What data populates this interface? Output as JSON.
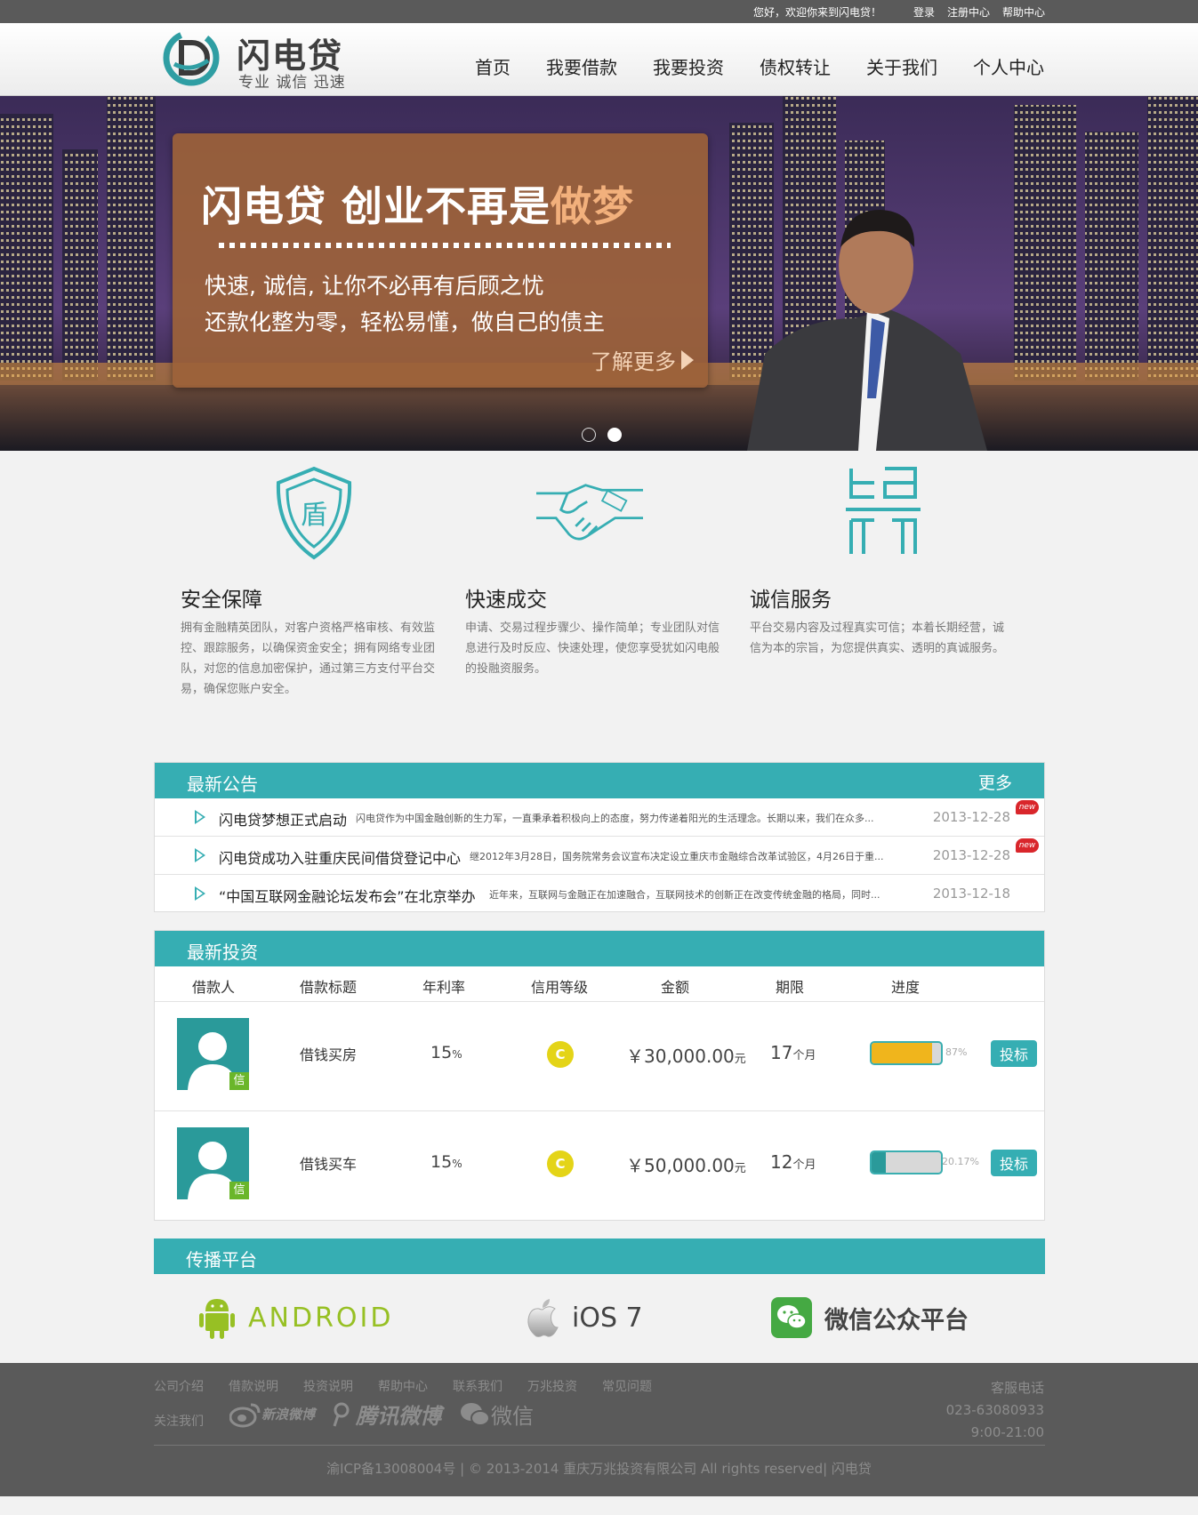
{
  "topbar": {
    "welcome": "您好，欢迎你来到闪电贷！",
    "login": "登录",
    "register": "注册中心",
    "help": "帮助中心"
  },
  "brand": {
    "name": "闪电贷",
    "slogan": "专业 诚信 迅速",
    "color": "#36aeb3"
  },
  "nav": [
    "首页",
    "我要借款",
    "我要投资",
    "债权转让",
    "关于我们",
    "个人中心"
  ],
  "banner": {
    "title_main": "闪电贷 创业不再是",
    "title_highlight": "做梦",
    "line1": "快速, 诚信, 让你不必再有后顾之忧",
    "line2": "还款化整为零，轻松易懂，做自己的债主",
    "more": "了解更多",
    "slides": 2,
    "active_slide": 2
  },
  "features": [
    {
      "icon": "shield-icon",
      "icon_text": "盾",
      "title": "安全保障",
      "desc": "拥有金融精英团队，对客户资格严格审核、有效监控、跟踪服务，以确保资金安全；拥有网络专业团队，对您的信息加密保护，通过第三方支付平台交易，确保您账户安全。"
    },
    {
      "icon": "handshake-icon",
      "title": "快速成交",
      "desc": "申请、交易过程步骤少、操作简单；专业团队对信息进行及时反应、快速处理，使您享受犹如闪电般的投融资服务。"
    },
    {
      "icon": "seal-icon",
      "title": "诚信服务",
      "desc": "平台交易内容及过程真实可信；本着长期经营，诚信为本的宗旨，为您提供真实、透明的真诚服务。"
    }
  ],
  "notices": {
    "title": "最新公告",
    "more": "更多",
    "items": [
      {
        "title": "闪电贷梦想正式启动",
        "summary": "闪电贷作为中国金融创新的生力军，一直秉承着积极向上的态度，努力传递着阳光的生活理念。长期以来，我们在众多...",
        "date": "2013-12-28",
        "badge": "new"
      },
      {
        "title": "闪电贷成功入驻重庆民间借贷登记中心",
        "summary": "继2012年3月28日，国务院常务会议宣布决定设立重庆市金融综合改革试验区，4月26日于重...",
        "date": "2013-12-28",
        "badge": "new"
      },
      {
        "title": "“中国互联网金融论坛发布会”在北京举办",
        "summary": "近年来，互联网与金融正在加速融合，互联网技术的创新正在改变传统金融的格局，同时...",
        "date": "2013-12-18",
        "badge": ""
      }
    ]
  },
  "investments": {
    "title": "最新投资",
    "columns": [
      "借款人",
      "借款标题",
      "年利率",
      "信用等级",
      "金额",
      "期限",
      "进度"
    ],
    "rows": [
      {
        "avatar_badge": "信",
        "loan": "借钱买房",
        "rate": "15",
        "rate_unit": "%",
        "grade": "C",
        "amount": "￥30,000.00",
        "amount_unit": "元",
        "term": "17",
        "term_unit": "个月",
        "progress": 0.87,
        "progress_label": "87%",
        "progress_color": "#f0b51c",
        "button": "投标"
      },
      {
        "avatar_badge": "信",
        "loan": "借钱买车",
        "rate": "15",
        "rate_unit": "%",
        "grade": "C",
        "amount": "￥50,000.00",
        "amount_unit": "元",
        "term": "12",
        "term_unit": "个月",
        "progress": 0.2017,
        "progress_label": "20.17%",
        "progress_color": "#2a9a9a",
        "button": "投标"
      }
    ]
  },
  "platforms": {
    "title": "传播平台",
    "items": [
      {
        "icon": "android-icon",
        "label": "ANDROID"
      },
      {
        "icon": "apple-icon",
        "label": "iOS 7"
      },
      {
        "icon": "wechat-icon",
        "label": "微信公众平台"
      }
    ]
  },
  "footer": {
    "links": [
      "公司介绍",
      "借款说明",
      "投资说明",
      "帮助中心",
      "联系我们",
      "万兆投资",
      "常见问题"
    ],
    "follow": "关注我们",
    "social": [
      {
        "icon": "sina-weibo-icon",
        "label": "新浪微博"
      },
      {
        "icon": "tencent-weibo-icon",
        "label": "腾讯微博"
      },
      {
        "icon": "wechat-icon",
        "label": "微信"
      }
    ],
    "hotline_label": "客服电话",
    "hotline_number": "023-63080933",
    "hotline_hours": "9:00-21:00",
    "copyright": "渝ICP备13008004号 | © 2013-2014 重庆万兆投资有限公司 All rights reserved| 闪电贷"
  }
}
